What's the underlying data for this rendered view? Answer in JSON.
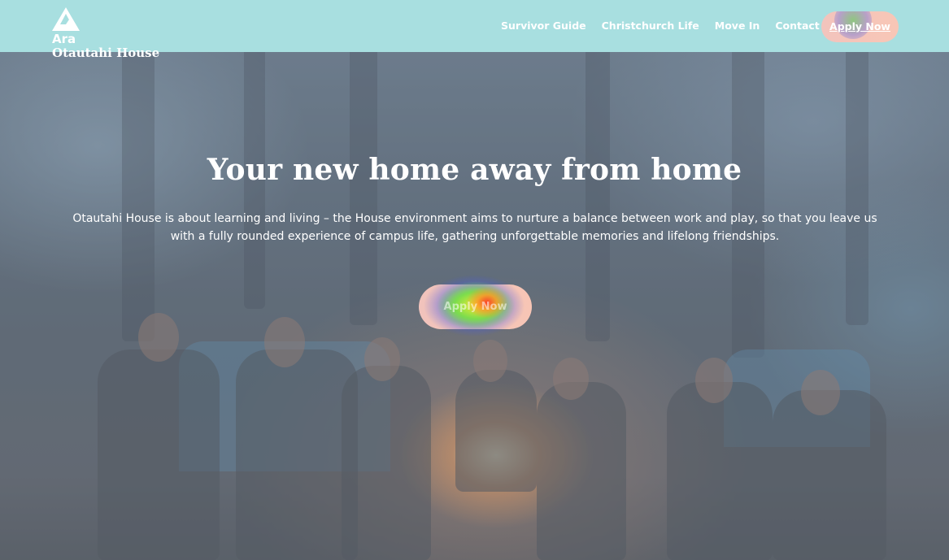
{
  "brand": {
    "line1": "Ara",
    "line2": "Otautahi House"
  },
  "nav": {
    "items": [
      "Survivor Guide",
      "Christchurch Life",
      "Move In",
      "Contact"
    ],
    "apply_label": "Apply Now"
  },
  "hero": {
    "title": "Your new home away from home",
    "description": "Otautahi House is about learning and living – the House environment aims to nurture a balance between work and play, so that you leave us with a fully rounded experience of campus life, gathering unforgettable memories and lifelong friendships.",
    "cta_label": "Apply Now"
  },
  "colors": {
    "header_bg": "#a8dfe0",
    "button_bg": "#f4c4b8",
    "text": "#ffffff"
  }
}
